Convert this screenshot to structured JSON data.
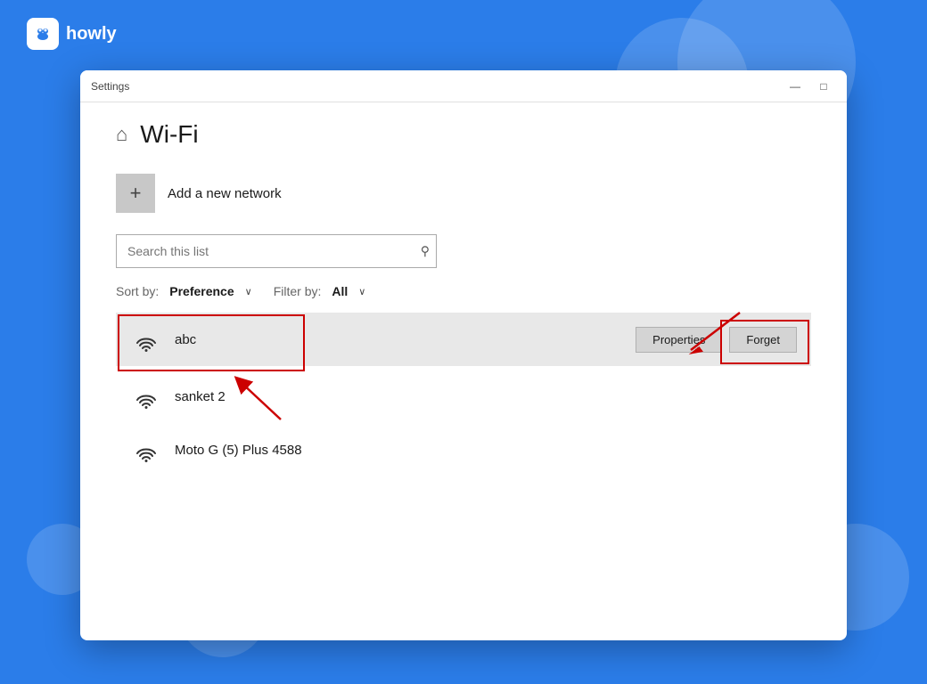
{
  "branding": {
    "logo_text": "howly",
    "logo_icon": "🐾"
  },
  "window": {
    "title": "Settings",
    "controls": {
      "minimize": "—",
      "maximize": "□"
    }
  },
  "page": {
    "title": "Wi-Fi",
    "home_icon": "⌂"
  },
  "add_network": {
    "button_label": "+",
    "label": "Add a new network"
  },
  "search": {
    "placeholder": "Search this list",
    "icon": "🔍"
  },
  "sort_filter": {
    "sort_label": "Sort by:",
    "sort_value": "Preference",
    "filter_label": "Filter by:",
    "filter_value": "All"
  },
  "networks": [
    {
      "name": "abc",
      "selected": true,
      "show_actions": true
    },
    {
      "name": "sanket 2",
      "selected": false,
      "show_actions": false
    },
    {
      "name": "Moto G (5) Plus 4588",
      "selected": false,
      "show_actions": false
    }
  ],
  "action_buttons": {
    "properties": "Properties",
    "forget": "Forget"
  }
}
